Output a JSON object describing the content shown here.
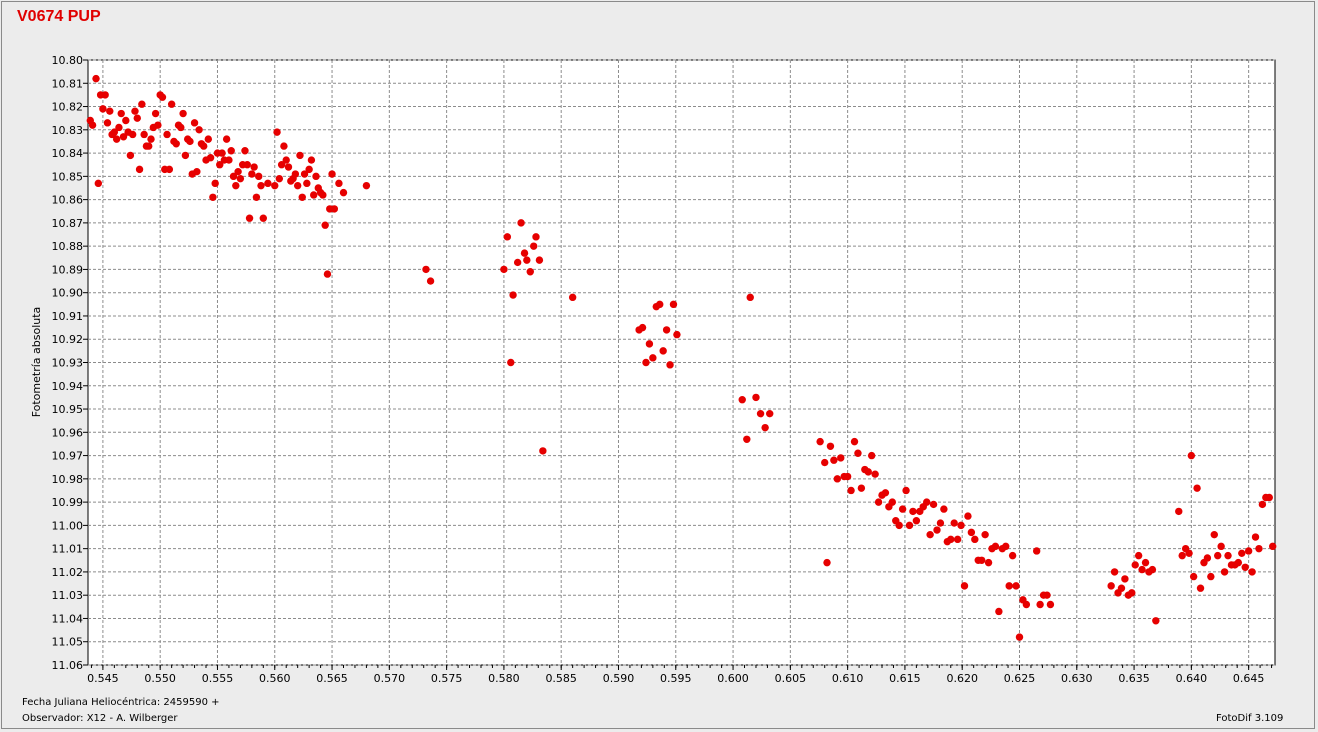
{
  "title": "V0674 PUP",
  "footer": {
    "jd_label": "Fecha Juliana Heliocéntrica: 2459590 +",
    "observer_label": "Observador: X12 - A. Wilberger",
    "software_label": "FotoDif 3.109"
  },
  "colors": {
    "title": "#e00000",
    "points": "#e60000",
    "plot_bg": "#ffffff",
    "window_bg": "#ececec"
  },
  "chart_data": {
    "type": "scatter",
    "title": "V0674 PUP",
    "xlabel": "Fecha Juliana Heliocéntrica: 2459590 +",
    "ylabel": "Fotometría absoluta",
    "xlim": [
      0.5437,
      0.6473
    ],
    "ylim": [
      10.8,
      11.06
    ],
    "y_inverted": true,
    "grid": true,
    "x_ticks": [
      "0.545",
      "0.550",
      "0.555",
      "0.560",
      "0.565",
      "0.570",
      "0.575",
      "0.580",
      "0.585",
      "0.590",
      "0.595",
      "0.600",
      "0.605",
      "0.610",
      "0.615",
      "0.620",
      "0.625",
      "0.630",
      "0.635",
      "0.640",
      "0.645"
    ],
    "y_ticks": [
      "10.80",
      "10.81",
      "10.82",
      "10.83",
      "10.84",
      "10.85",
      "10.86",
      "10.87",
      "10.88",
      "10.89",
      "10.90",
      "10.91",
      "10.92",
      "10.93",
      "10.94",
      "10.95",
      "10.96",
      "10.97",
      "10.98",
      "10.99",
      "11.00",
      "11.01",
      "11.02",
      "11.03",
      "11.04",
      "11.05",
      "11.06"
    ],
    "points": [
      [
        0.5439,
        10.826
      ],
      [
        0.5441,
        10.828
      ],
      [
        0.5444,
        10.808
      ],
      [
        0.5446,
        10.853
      ],
      [
        0.5448,
        10.815
      ],
      [
        0.545,
        10.821
      ],
      [
        0.5452,
        10.815
      ],
      [
        0.5454,
        10.827
      ],
      [
        0.5456,
        10.822
      ],
      [
        0.5458,
        10.832
      ],
      [
        0.546,
        10.831
      ],
      [
        0.5462,
        10.834
      ],
      [
        0.5464,
        10.829
      ],
      [
        0.5466,
        10.823
      ],
      [
        0.5468,
        10.833
      ],
      [
        0.547,
        10.826
      ],
      [
        0.5472,
        10.831
      ],
      [
        0.5474,
        10.841
      ],
      [
        0.5476,
        10.832
      ],
      [
        0.5478,
        10.822
      ],
      [
        0.548,
        10.825
      ],
      [
        0.5482,
        10.847
      ],
      [
        0.5484,
        10.819
      ],
      [
        0.5486,
        10.832
      ],
      [
        0.5488,
        10.837
      ],
      [
        0.549,
        10.837
      ],
      [
        0.5492,
        10.834
      ],
      [
        0.5494,
        10.829
      ],
      [
        0.5496,
        10.823
      ],
      [
        0.5498,
        10.828
      ],
      [
        0.55,
        10.815
      ],
      [
        0.5502,
        10.816
      ],
      [
        0.5504,
        10.847
      ],
      [
        0.5506,
        10.832
      ],
      [
        0.5508,
        10.847
      ],
      [
        0.551,
        10.819
      ],
      [
        0.5512,
        10.835
      ],
      [
        0.5514,
        10.836
      ],
      [
        0.5516,
        10.828
      ],
      [
        0.5518,
        10.829
      ],
      [
        0.552,
        10.823
      ],
      [
        0.5522,
        10.841
      ],
      [
        0.5524,
        10.834
      ],
      [
        0.5526,
        10.835
      ],
      [
        0.5528,
        10.849
      ],
      [
        0.553,
        10.827
      ],
      [
        0.5532,
        10.848
      ],
      [
        0.5534,
        10.83
      ],
      [
        0.5536,
        10.836
      ],
      [
        0.5538,
        10.837
      ],
      [
        0.554,
        10.843
      ],
      [
        0.5542,
        10.834
      ],
      [
        0.5544,
        10.842
      ],
      [
        0.5546,
        10.859
      ],
      [
        0.5548,
        10.853
      ],
      [
        0.555,
        10.84
      ],
      [
        0.5552,
        10.845
      ],
      [
        0.5554,
        10.84
      ],
      [
        0.5556,
        10.843
      ],
      [
        0.5558,
        10.834
      ],
      [
        0.556,
        10.843
      ],
      [
        0.5562,
        10.839
      ],
      [
        0.5564,
        10.85
      ],
      [
        0.5566,
        10.854
      ],
      [
        0.5568,
        10.848
      ],
      [
        0.557,
        10.851
      ],
      [
        0.5572,
        10.845
      ],
      [
        0.5574,
        10.839
      ],
      [
        0.5576,
        10.845
      ],
      [
        0.5578,
        10.868
      ],
      [
        0.558,
        10.849
      ],
      [
        0.5582,
        10.846
      ],
      [
        0.5584,
        10.859
      ],
      [
        0.5586,
        10.85
      ],
      [
        0.5588,
        10.854
      ],
      [
        0.559,
        10.868
      ],
      [
        0.5594,
        10.853
      ],
      [
        0.56,
        10.854
      ],
      [
        0.5602,
        10.831
      ],
      [
        0.5604,
        10.851
      ],
      [
        0.5606,
        10.845
      ],
      [
        0.5608,
        10.837
      ],
      [
        0.561,
        10.843
      ],
      [
        0.5612,
        10.846
      ],
      [
        0.5614,
        10.852
      ],
      [
        0.5616,
        10.851
      ],
      [
        0.5618,
        10.849
      ],
      [
        0.562,
        10.854
      ],
      [
        0.5622,
        10.841
      ],
      [
        0.5624,
        10.859
      ],
      [
        0.5626,
        10.849
      ],
      [
        0.5628,
        10.853
      ],
      [
        0.563,
        10.847
      ],
      [
        0.5632,
        10.843
      ],
      [
        0.5634,
        10.858
      ],
      [
        0.5636,
        10.85
      ],
      [
        0.5638,
        10.855
      ],
      [
        0.564,
        10.857
      ],
      [
        0.5642,
        10.858
      ],
      [
        0.5644,
        10.871
      ],
      [
        0.5646,
        10.892
      ],
      [
        0.5648,
        10.864
      ],
      [
        0.565,
        10.849
      ],
      [
        0.5652,
        10.864
      ],
      [
        0.5656,
        10.853
      ],
      [
        0.566,
        10.857
      ],
      [
        0.568,
        10.854
      ],
      [
        0.5732,
        10.89
      ],
      [
        0.5736,
        10.895
      ],
      [
        0.58,
        10.89
      ],
      [
        0.5803,
        10.876
      ],
      [
        0.5806,
        10.93
      ],
      [
        0.5808,
        10.901
      ],
      [
        0.5812,
        10.887
      ],
      [
        0.5815,
        10.87
      ],
      [
        0.5818,
        10.883
      ],
      [
        0.582,
        10.886
      ],
      [
        0.5823,
        10.891
      ],
      [
        0.5826,
        10.88
      ],
      [
        0.5828,
        10.876
      ],
      [
        0.5831,
        10.886
      ],
      [
        0.5834,
        10.968
      ],
      [
        0.586,
        10.902
      ],
      [
        0.5918,
        10.916
      ],
      [
        0.5921,
        10.915
      ],
      [
        0.5924,
        10.93
      ],
      [
        0.5927,
        10.922
      ],
      [
        0.593,
        10.928
      ],
      [
        0.5933,
        10.906
      ],
      [
        0.5936,
        10.905
      ],
      [
        0.5939,
        10.925
      ],
      [
        0.5942,
        10.916
      ],
      [
        0.5945,
        10.931
      ],
      [
        0.5948,
        10.905
      ],
      [
        0.5951,
        10.918
      ],
      [
        0.6008,
        10.946
      ],
      [
        0.6012,
        10.963
      ],
      [
        0.6015,
        10.902
      ],
      [
        0.602,
        10.945
      ],
      [
        0.6024,
        10.952
      ],
      [
        0.6028,
        10.958
      ],
      [
        0.6032,
        10.952
      ],
      [
        0.6076,
        10.964
      ],
      [
        0.608,
        10.973
      ],
      [
        0.6082,
        11.016
      ],
      [
        0.6085,
        10.966
      ],
      [
        0.6088,
        10.972
      ],
      [
        0.6091,
        10.98
      ],
      [
        0.6094,
        10.971
      ],
      [
        0.6097,
        10.979
      ],
      [
        0.61,
        10.979
      ],
      [
        0.6103,
        10.985
      ],
      [
        0.6106,
        10.964
      ],
      [
        0.6109,
        10.969
      ],
      [
        0.6112,
        10.984
      ],
      [
        0.6115,
        10.976
      ],
      [
        0.6118,
        10.977
      ],
      [
        0.6121,
        10.97
      ],
      [
        0.6124,
        10.978
      ],
      [
        0.6127,
        10.99
      ],
      [
        0.613,
        10.987
      ],
      [
        0.6133,
        10.986
      ],
      [
        0.6136,
        10.992
      ],
      [
        0.6139,
        10.99
      ],
      [
        0.6142,
        10.998
      ],
      [
        0.6145,
        11.0
      ],
      [
        0.6148,
        10.993
      ],
      [
        0.6151,
        10.985
      ],
      [
        0.6154,
        11.0
      ],
      [
        0.6157,
        10.994
      ],
      [
        0.616,
        10.998
      ],
      [
        0.6163,
        10.994
      ],
      [
        0.6166,
        10.992
      ],
      [
        0.6169,
        10.99
      ],
      [
        0.6172,
        11.004
      ],
      [
        0.6175,
        10.991
      ],
      [
        0.6178,
        11.002
      ],
      [
        0.6181,
        10.999
      ],
      [
        0.6184,
        10.993
      ],
      [
        0.6187,
        11.007
      ],
      [
        0.619,
        11.006
      ],
      [
        0.6193,
        10.999
      ],
      [
        0.6196,
        11.006
      ],
      [
        0.6199,
        11.0
      ],
      [
        0.6202,
        11.026
      ],
      [
        0.6205,
        10.996
      ],
      [
        0.6208,
        11.003
      ],
      [
        0.6211,
        11.006
      ],
      [
        0.6214,
        11.015
      ],
      [
        0.6217,
        11.015
      ],
      [
        0.622,
        11.004
      ],
      [
        0.6223,
        11.016
      ],
      [
        0.6226,
        11.01
      ],
      [
        0.6229,
        11.009
      ],
      [
        0.6232,
        11.037
      ],
      [
        0.6235,
        11.01
      ],
      [
        0.6238,
        11.009
      ],
      [
        0.6241,
        11.026
      ],
      [
        0.6244,
        11.013
      ],
      [
        0.6247,
        11.026
      ],
      [
        0.625,
        11.048
      ],
      [
        0.6253,
        11.032
      ],
      [
        0.6256,
        11.034
      ],
      [
        0.6265,
        11.011
      ],
      [
        0.6268,
        11.034
      ],
      [
        0.6271,
        11.03
      ],
      [
        0.6274,
        11.03
      ],
      [
        0.6277,
        11.034
      ],
      [
        0.633,
        11.026
      ],
      [
        0.6333,
        11.02
      ],
      [
        0.6336,
        11.029
      ],
      [
        0.6339,
        11.027
      ],
      [
        0.6342,
        11.023
      ],
      [
        0.6345,
        11.03
      ],
      [
        0.6348,
        11.029
      ],
      [
        0.6351,
        11.017
      ],
      [
        0.6354,
        11.013
      ],
      [
        0.6357,
        11.019
      ],
      [
        0.636,
        11.016
      ],
      [
        0.6363,
        11.02
      ],
      [
        0.6366,
        11.019
      ],
      [
        0.6369,
        11.041
      ],
      [
        0.6389,
        10.994
      ],
      [
        0.6392,
        11.013
      ],
      [
        0.6395,
        11.01
      ],
      [
        0.6398,
        11.012
      ],
      [
        0.64,
        10.97
      ],
      [
        0.6402,
        11.022
      ],
      [
        0.6405,
        10.984
      ],
      [
        0.6408,
        11.027
      ],
      [
        0.6411,
        11.016
      ],
      [
        0.6414,
        11.014
      ],
      [
        0.6417,
        11.022
      ],
      [
        0.642,
        11.004
      ],
      [
        0.6423,
        11.013
      ],
      [
        0.6426,
        11.009
      ],
      [
        0.6429,
        11.02
      ],
      [
        0.6432,
        11.013
      ],
      [
        0.6435,
        11.017
      ],
      [
        0.6438,
        11.017
      ],
      [
        0.6441,
        11.016
      ],
      [
        0.6444,
        11.012
      ],
      [
        0.6447,
        11.018
      ],
      [
        0.645,
        11.011
      ],
      [
        0.6453,
        11.02
      ],
      [
        0.6456,
        11.005
      ],
      [
        0.6459,
        11.01
      ],
      [
        0.6462,
        10.991
      ],
      [
        0.6465,
        10.988
      ],
      [
        0.6468,
        10.988
      ],
      [
        0.6471,
        11.009
      ]
    ]
  }
}
